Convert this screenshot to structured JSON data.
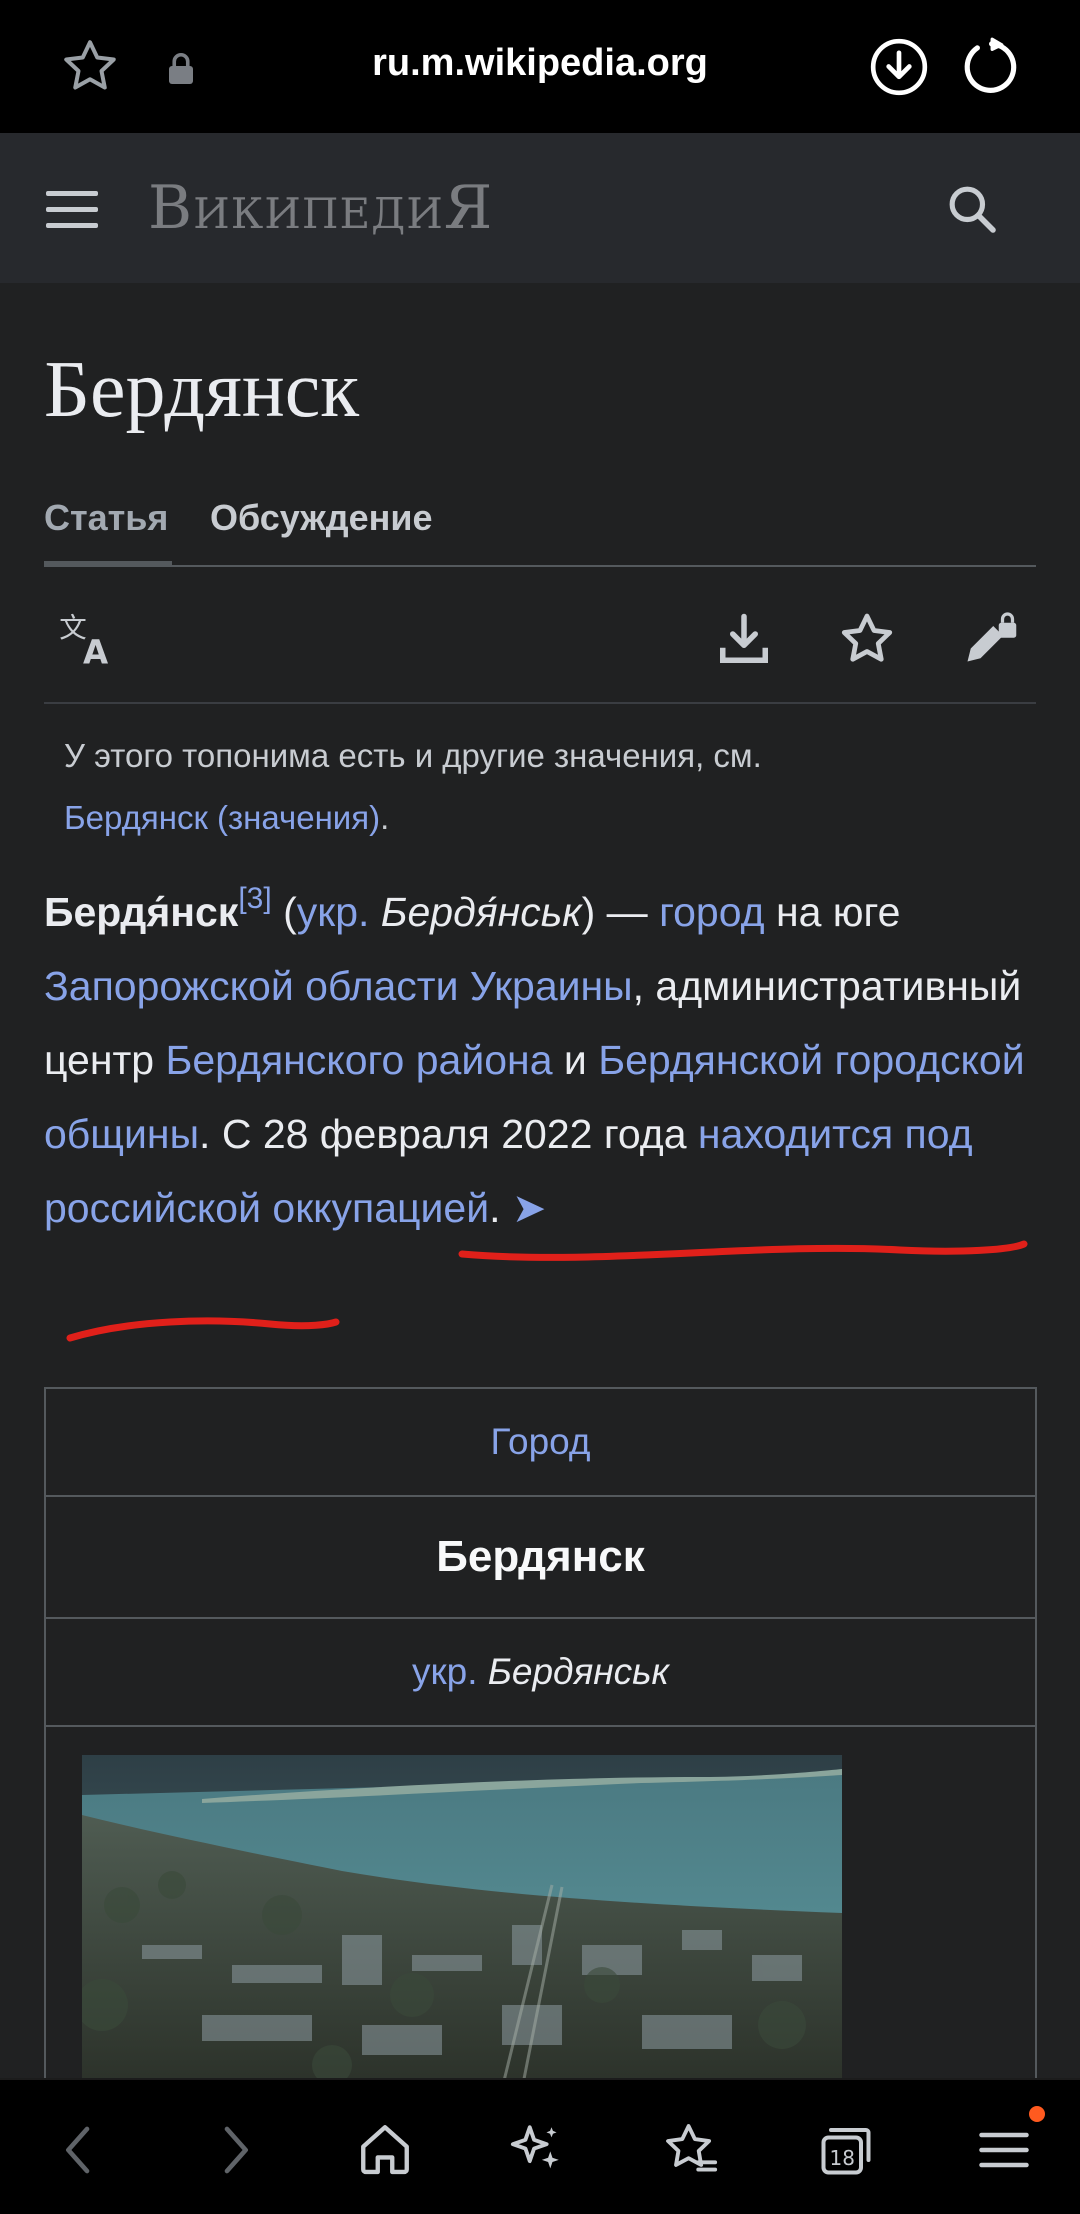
{
  "browser": {
    "url": "ru.m.wikipedia.org",
    "tab_count": "18"
  },
  "wiki": {
    "logo_text": "ВикипедиЯ"
  },
  "page": {
    "title": "Бердянск",
    "tabs": [
      {
        "label": "Статья"
      },
      {
        "label": "Обсуждение"
      }
    ]
  },
  "hatnote": {
    "line1": "У этого топонима есть и другие значения, см.",
    "link": "Бердянск (значения)",
    "end": "."
  },
  "lead": {
    "bold_name": "Бердя́нск",
    "ref": "[3]",
    "t1": " (",
    "ukr": "укр.",
    "ukr_name": " Бердя́нськ",
    "t2": ") — ",
    "city_link": "город",
    "t3": " на юге ",
    "oblast_link": "Запорожской области Украины",
    "t4": ", административный центр ",
    "raion_link": "Бердянского района",
    "t5": " и ",
    "hromada_link": "Бердянской городской общины",
    "t6": ". С 28 февраля 2022 года ",
    "occupation_link": "находится под российской оккупацией",
    "t7": ". ",
    "arrow": "➤"
  },
  "infobox": {
    "type": "Город",
    "name": "Бердянск",
    "native_prefix": "укр.",
    "native_name": " Бердянськ"
  },
  "colors": {
    "link": "#88a3e8",
    "annotation": "#e0201a",
    "notification_dot": "#ff5a1f"
  }
}
